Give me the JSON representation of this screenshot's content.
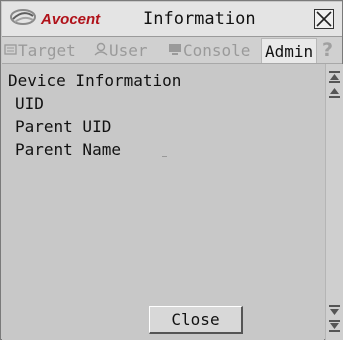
{
  "window": {
    "logo_text": "Avocent",
    "title": "Information"
  },
  "tabs": [
    {
      "label": "Target",
      "icon": "target-icon",
      "active": false
    },
    {
      "label": "User",
      "icon": "user-icon",
      "active": false
    },
    {
      "label": "Console",
      "icon": "console-icon",
      "active": false
    },
    {
      "label": "Admin",
      "active": true
    }
  ],
  "help_glyph": "?",
  "main": {
    "heading": "Device Information",
    "fields": [
      {
        "label": "UID"
      },
      {
        "label": "Parent UID"
      },
      {
        "label": "Parent Name"
      }
    ],
    "close_label": "Close"
  },
  "colors": {
    "brand_red": "#b0121a",
    "window_bg": "#c8c8c8",
    "titlebar_bg": "#e4e4e4",
    "inactive_tab": "#9a9a9a"
  }
}
